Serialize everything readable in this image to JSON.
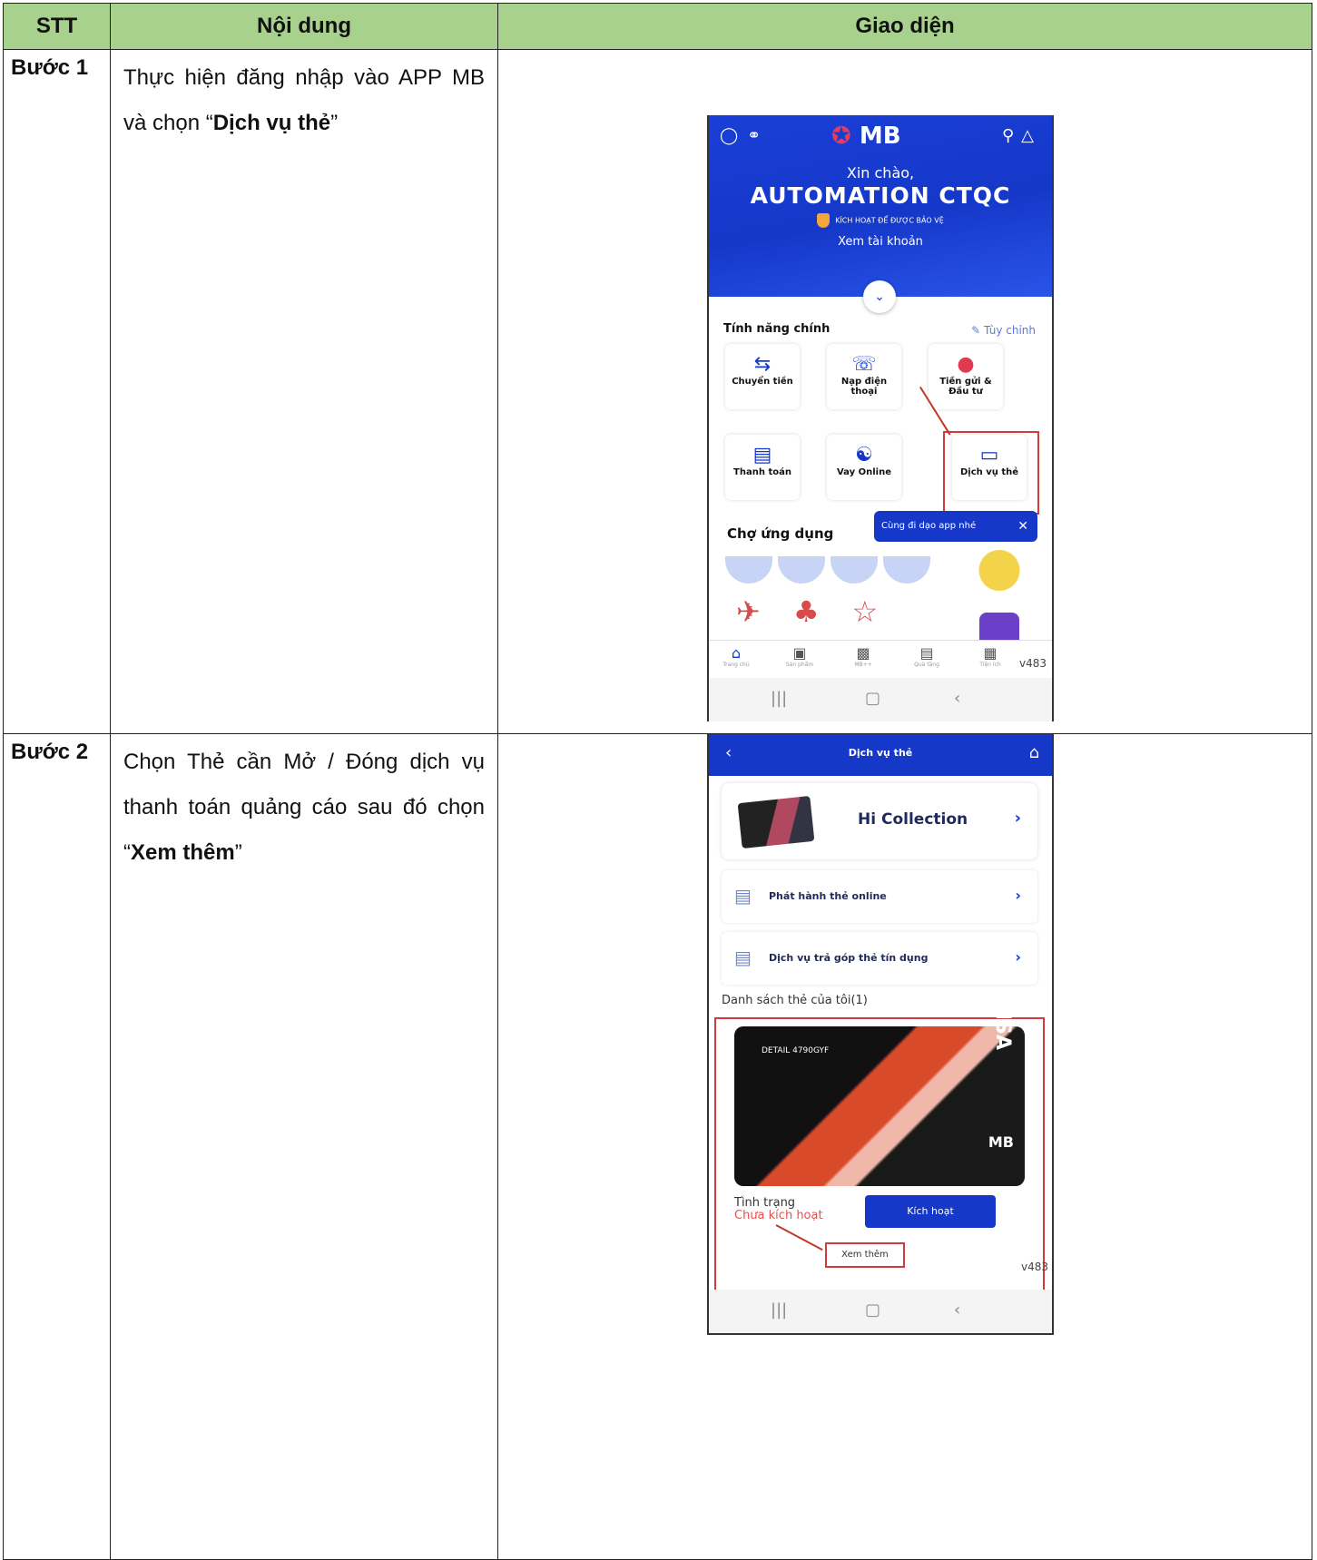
{
  "table": {
    "headers": [
      "STT",
      "Nội dung",
      "Giao diện"
    ],
    "rows": [
      {
        "step": "Bước 1",
        "content_before": "Thực hiện đăng nhập vào APP MB và chọn “",
        "content_bold": "Dịch vụ thẻ",
        "content_after": "”"
      },
      {
        "step": "Bước 2",
        "content_before": "Chọn Thẻ cần Mở / Đóng dịch vụ thanh toán quảng cáo sau đó chọn “",
        "content_bold": "Xem thêm",
        "content_after": "”"
      }
    ]
  },
  "phone1": {
    "logo": "MB",
    "greeting": "Xin chào,",
    "user_name": "AUTOMATION CTQC",
    "protect_text": "KÍCH HOẠT ĐỂ ĐƯỢC BẢO VỆ",
    "view_account": "Xem tài khoản",
    "section_main": "Tính năng chính",
    "customize": "Tùy chỉnh",
    "tiles": [
      "Chuyển tiền",
      "Nạp điện thoại",
      "Tiền gửi & Đầu tư",
      "Thanh toán",
      "Vay Online",
      "Dịch vụ thẻ"
    ],
    "section_market": "Chợ ứng dụng",
    "tip": "Cùng đi dạo app nhé",
    "nav": [
      "Trang chủ",
      "Sản phẩm",
      "MB++",
      "Quà tặng",
      "Tiện ích"
    ],
    "version": "v483"
  },
  "phone2": {
    "title": "Dịch vụ thẻ",
    "collection": "Hi Collection",
    "row1": "Phát hành thẻ online",
    "row2": "Dịch vụ trả góp thẻ tín dụng",
    "list_title": "Danh sách thẻ của tôi(1)",
    "card_number": "DETAIL 4790GYF",
    "card_brand": "VISA",
    "card_bank": "MB",
    "status_label": "Tình trạng",
    "status_value": "Chưa kích hoạt",
    "activate": "Kích hoạt",
    "view_more": "Xem thêm",
    "version": "v483"
  },
  "colors": {
    "header_bg": "#a9d18e",
    "mb_blue": "#1538c9",
    "highlight_red": "#d23b3b"
  }
}
